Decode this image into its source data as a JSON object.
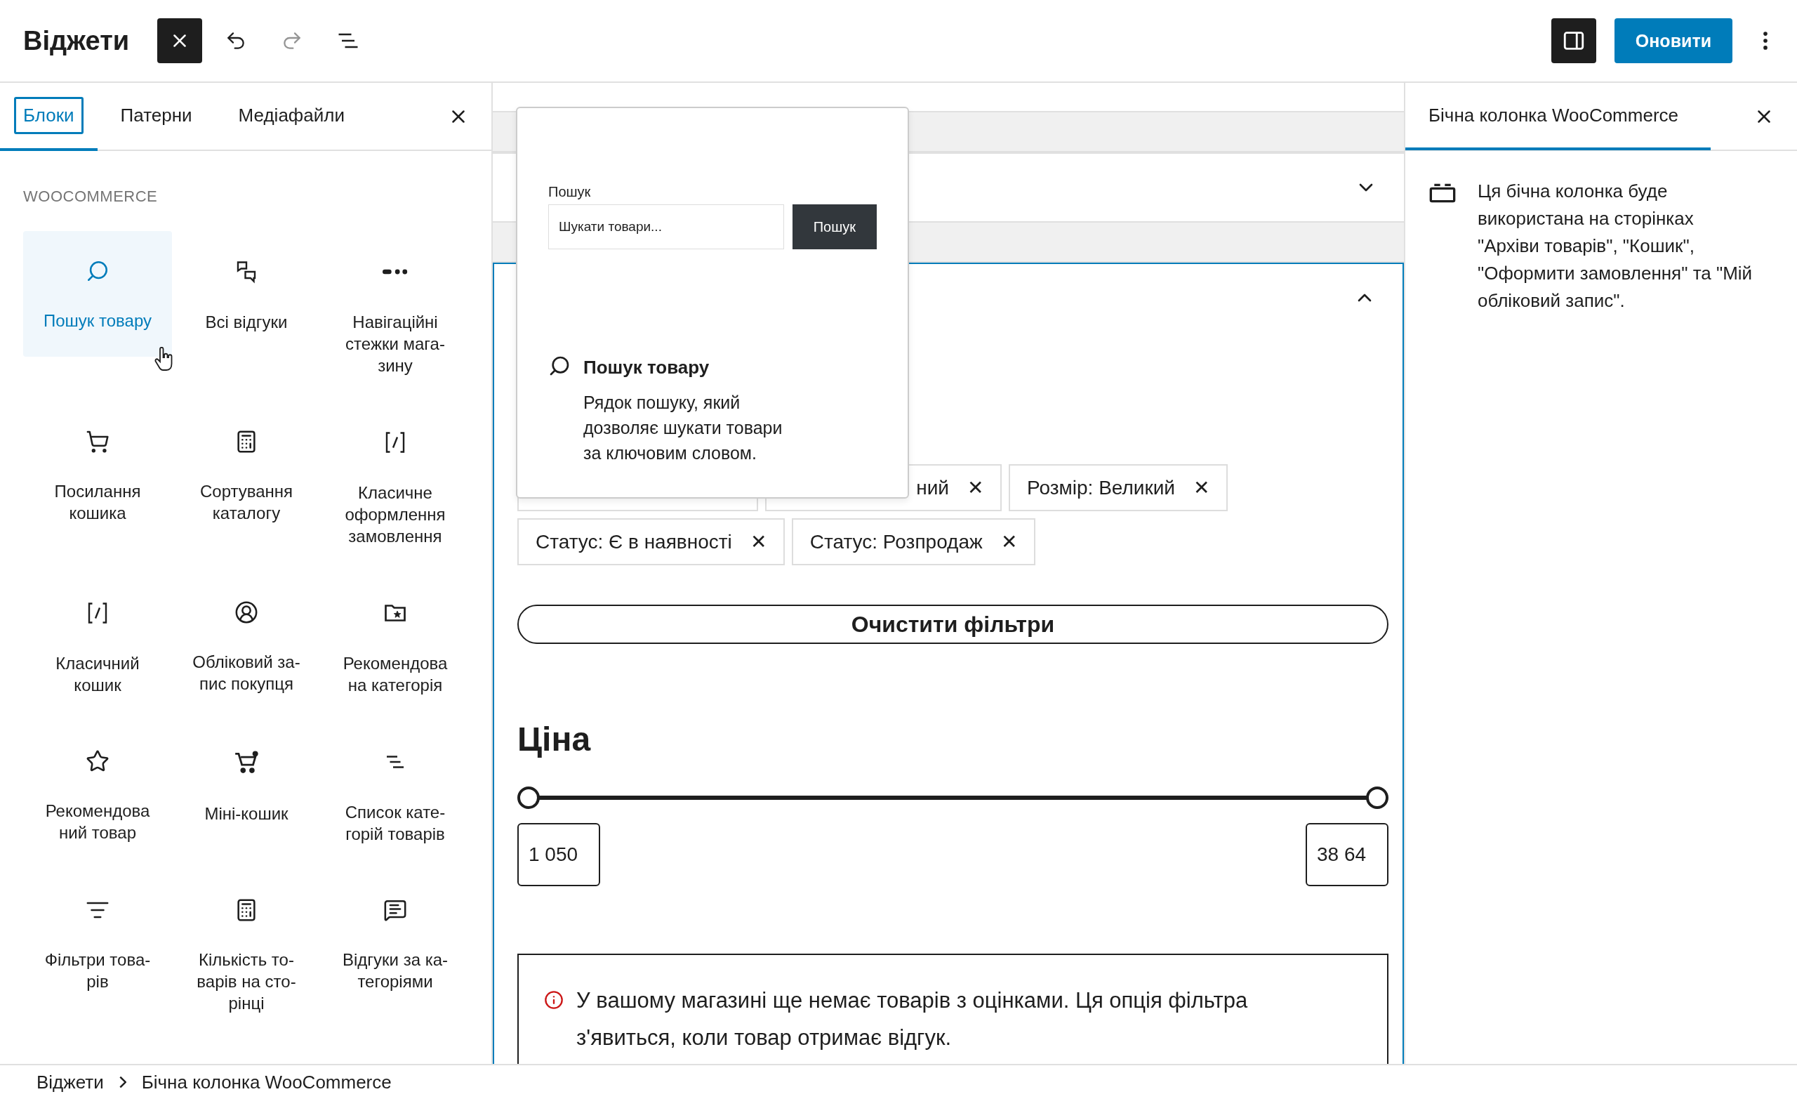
{
  "header": {
    "title": "Віджети",
    "inserter_toggle": {
      "pressed": true
    },
    "undo": {
      "disabled": false
    },
    "redo": {
      "disabled": true
    },
    "settings_toggle": {
      "pressed": true
    },
    "update_button": "Оновити"
  },
  "inserter": {
    "tabs": [
      {
        "label": "Блоки",
        "selected": true
      },
      {
        "label": "Патерни",
        "selected": false
      },
      {
        "label": "Медіафайли",
        "selected": false
      }
    ],
    "category": "WOOCOMMERCE",
    "blocks": [
      {
        "label": "Пошук товару",
        "selected": true
      },
      {
        "label": "Всі відгуки",
        "selected": false
      },
      {
        "label": "Навігаційні\nстежки мага-\nзину",
        "selected": false
      },
      {
        "label": "Посилання\nкошика",
        "selected": false
      },
      {
        "label": "Сортування\nкаталогу",
        "selected": false
      },
      {
        "label": "Класичне\nоформлення\nзамовлення",
        "selected": false
      },
      {
        "label": "Класичний\nкошик",
        "selected": false
      },
      {
        "label": "Обліковий за-\nпис покупця",
        "selected": false
      },
      {
        "label": "Рекомендова\nна категорія",
        "selected": false
      },
      {
        "label": "Рекомендова\nний товар",
        "selected": false
      },
      {
        "label": "Міні-кошик",
        "selected": false
      },
      {
        "label": "Список кате-\nгорій товарів",
        "selected": false
      },
      {
        "label": "Фільтри това-\nрів",
        "selected": false
      },
      {
        "label": "Кількість то-\nварів на сто-\nрінці",
        "selected": false
      },
      {
        "label": "Відгуки за ка-\nтегоріями",
        "selected": false
      }
    ]
  },
  "canvas": {
    "areas": [
      {
        "expanded": false,
        "selected": false
      },
      {
        "expanded": true,
        "selected": true
      }
    ],
    "chips": [
      [
        {
          "kind": "covered"
        },
        {
          "kind": "covered",
          "label": "ний",
          "remove": "✕"
        },
        {
          "kind": "chip",
          "label": "Розмір: Великий",
          "remove": "✕"
        }
      ],
      [
        {
          "kind": "chip",
          "label": "Статус: Є в наявності",
          "remove": "✕"
        },
        {
          "kind": "chip",
          "label": "Статус: Розпродаж",
          "remove": "✕"
        }
      ]
    ],
    "clear_button": "Очистити фільтри",
    "price_heading": "Ціна",
    "price_thumbs": [
      {
        "level": 0
      },
      {
        "level": 1
      }
    ],
    "min_price": "1 050",
    "max_price": "38 64",
    "notice": "У вашому магазині ще немає товарів з оцінками. Ця опція фільтра з'явиться, коли товар отримає відгук."
  },
  "preview": {
    "search_label": "Пошук",
    "search_placeholder": "Шукати товари...",
    "search_button": "Пошук",
    "block_title": "Пошук товару",
    "block_description": "Рядок пошуку, який дозволяє шукати товари за ключовим словом."
  },
  "sidebar": {
    "title": "Бічна колонка WooCommerce",
    "description": "Ця бічна колонка буде використана на сторінках \"Архіви товарів\", \"Кошик\", \"Оформити замовлення\" та \"Мій обліковий запис\"."
  },
  "breadcrumbs": [
    "Віджети",
    "Бічна колонка WooCommerce"
  ]
}
